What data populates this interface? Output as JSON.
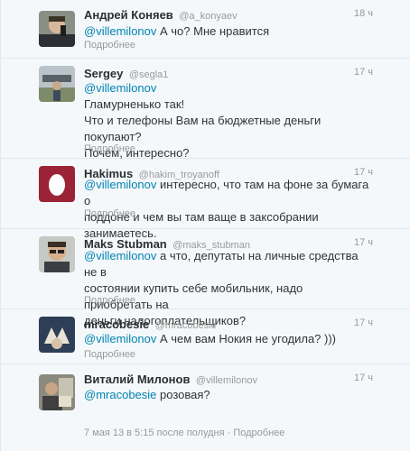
{
  "tweets": [
    {
      "name": "Андрей Коняев",
      "handle": "@a_konyaev",
      "time": "18 ч",
      "mention": "@villemilonov",
      "lines": [
        " А чо? Мне нравится"
      ],
      "more": "Подробнее"
    },
    {
      "name": "Sergey",
      "handle": "@segla1",
      "time": "17 ч",
      "mention": "@villemilonov",
      "lines": [
        "Гламурненько так!",
        "Что и телефоны Вам на бюджетные деньги покупают?",
        "Почём, интересно?"
      ],
      "more": "Подробнее"
    },
    {
      "name": "Hakimus",
      "handle": "@hakim_troyanoff",
      "time": "17 ч",
      "mention": "@villemilonov",
      "lines": [
        " интересно, что там на фоне за бумага о",
        "поддоне и чем вы там ваще в заксобрании занимаетесь."
      ],
      "more": "Подробнее"
    },
    {
      "name": "Maks Stubman",
      "handle": "@maks_stubman",
      "time": "17 ч",
      "mention": "@villemilonov",
      "lines": [
        " а что, депутаты на личные средства не в",
        "состоянии купить себе мобильник, надо приобретать на",
        "деньги налогоплательщиков?"
      ],
      "more": "Подробнее"
    },
    {
      "name": "mracobesie",
      "handle": "@mracobesie",
      "time": "17 ч",
      "mention": "@villemilonov",
      "lines": [
        " А чем вам Нокия не угодила? )))"
      ],
      "more": "Подробнее"
    },
    {
      "name": "Виталий Милонов",
      "handle": "@villemilonov",
      "time": "17 ч",
      "mention": "@mracobesie",
      "lines": [
        " розовая?"
      ],
      "more": ""
    }
  ],
  "footer": {
    "date": "7 мая 13 в 5:15 после полудня",
    "separator": "·",
    "more": "Подробнее"
  },
  "colors": {
    "link": "#0084b4",
    "meta": "#999999",
    "background": "#f5f8fa"
  }
}
